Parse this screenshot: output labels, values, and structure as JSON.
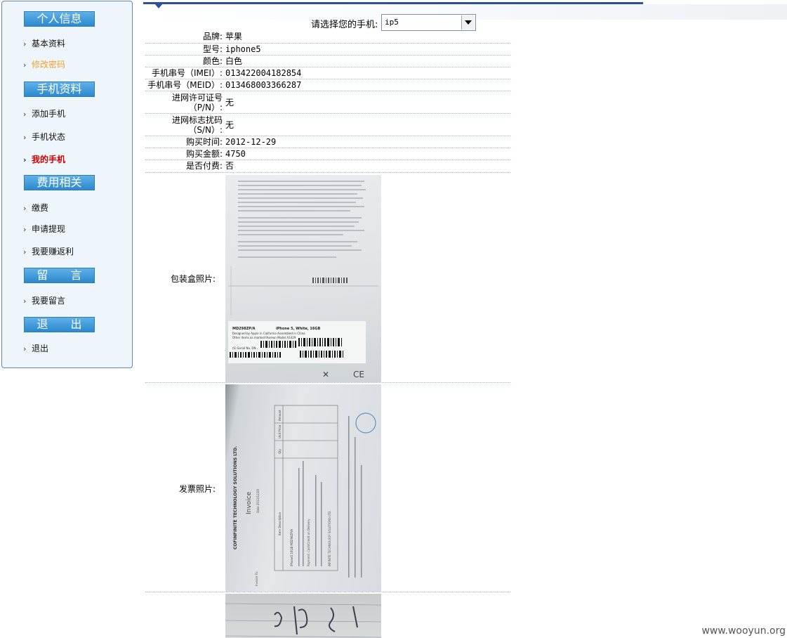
{
  "sidebar": {
    "sections": [
      {
        "title": "个人信息",
        "items": [
          {
            "label": "基本资料",
            "state": "normal"
          },
          {
            "label": "修改密码",
            "state": "visited"
          }
        ]
      },
      {
        "title": "手机资料",
        "items": [
          {
            "label": "添加手机",
            "state": "normal"
          },
          {
            "label": "手机状态",
            "state": "normal"
          },
          {
            "label": "我的手机",
            "state": "active"
          }
        ]
      },
      {
        "title": "费用相关",
        "items": [
          {
            "label": "缴费",
            "state": "normal"
          },
          {
            "label": "申请提现",
            "state": "normal"
          },
          {
            "label": "我要赚返利",
            "state": "normal"
          }
        ]
      },
      {
        "title": "留　　言",
        "items": [
          {
            "label": "我要留言",
            "state": "normal"
          }
        ]
      },
      {
        "title": "退　　出",
        "items": [
          {
            "label": "退出",
            "state": "normal"
          }
        ]
      }
    ],
    "chevron": "›"
  },
  "phone_select": {
    "label": "请选择您的手机:",
    "value": "ip5"
  },
  "details": [
    {
      "label": "品牌:",
      "value": "苹果"
    },
    {
      "label": "型号:",
      "value": "iphone5"
    },
    {
      "label": "颜色:",
      "value": "白色"
    },
    {
      "label": "手机串号（IMEI）:",
      "value": "013422004182854"
    },
    {
      "label": "手机串号（MEID）:",
      "value": "013468003366287"
    },
    {
      "label": "进网许可证号（P/N）:",
      "value": "无"
    },
    {
      "label": "进网标志扰码（S/N）:",
      "value": "无"
    },
    {
      "label": "购买时间:",
      "value": "2012-12-29"
    },
    {
      "label": "购买金额:",
      "value": "4750"
    },
    {
      "label": "是否付费:",
      "value": "否"
    }
  ],
  "photos": {
    "box_label": "包装盒照片:",
    "invoice_label": "发票照片:",
    "box_text": {
      "model_line": "MD298ZP/A",
      "product_line": "iPhone 5, White, 16GB",
      "design_line": "Designed by Apple in California  Assembled in China",
      "other_line": "Other items as marked thereon  Model A1429",
      "serial_line": "(S) Serial No. DN...",
      "cert": "CE"
    },
    "invoice_text": {
      "company": "COFINFINITE TECHNOLOGY SOLUTIONS LTD.",
      "title": "Invoice",
      "date": "Date 2012/12/29",
      "columns": [
        "Item Description",
        "Qty",
        "Unit Price",
        "Amount"
      ],
      "item": "iPhone5 16GB MD298ZP/A",
      "invoice_to": "Invoice To:",
      "remark": "Payment: Cash/Credit on Delivery",
      "footer": "INFINITE TECHNOLOGY SOLUTIONS LTD."
    }
  },
  "watermark": "www.wooyun.org",
  "colors": {
    "accent": "#2c4e9d",
    "section_head": "#2c89cc",
    "active_item": "#cc0000",
    "visited_item": "#f2a12c"
  }
}
